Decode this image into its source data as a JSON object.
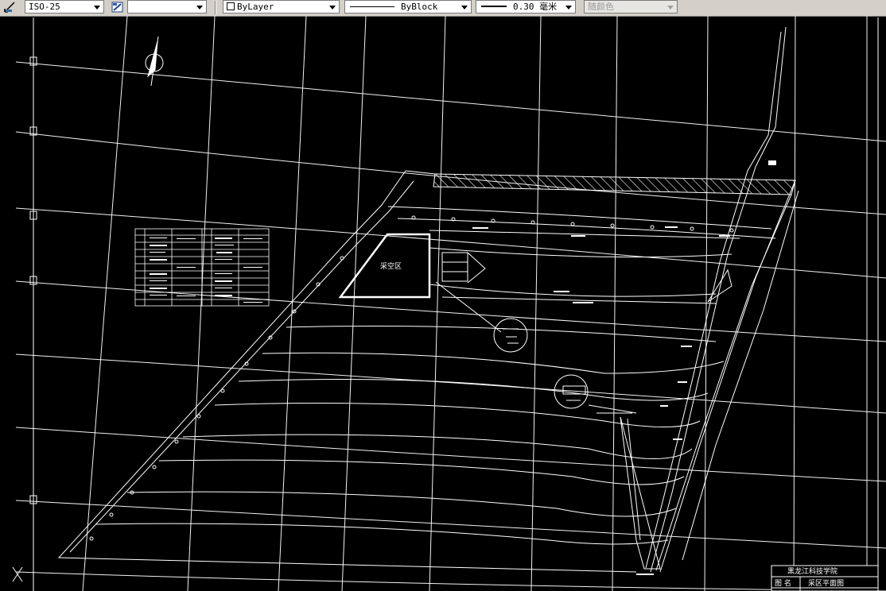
{
  "toolbar": {
    "dimstyle": "ISO-25",
    "layer": "",
    "color": "ByLayer",
    "linetype": "ByBlock",
    "lineweight": "0.30 毫米",
    "plotstyle": "随颜色"
  },
  "drawing": {
    "area_label": "采空区",
    "title_block": {
      "org": "黑龙江科技学院",
      "label_name": "图 名",
      "drawing_name": "采区平面图"
    }
  },
  "colors": {
    "background": "#000000",
    "lines": "#ffffff",
    "toolbar": "#d4d0c8"
  }
}
